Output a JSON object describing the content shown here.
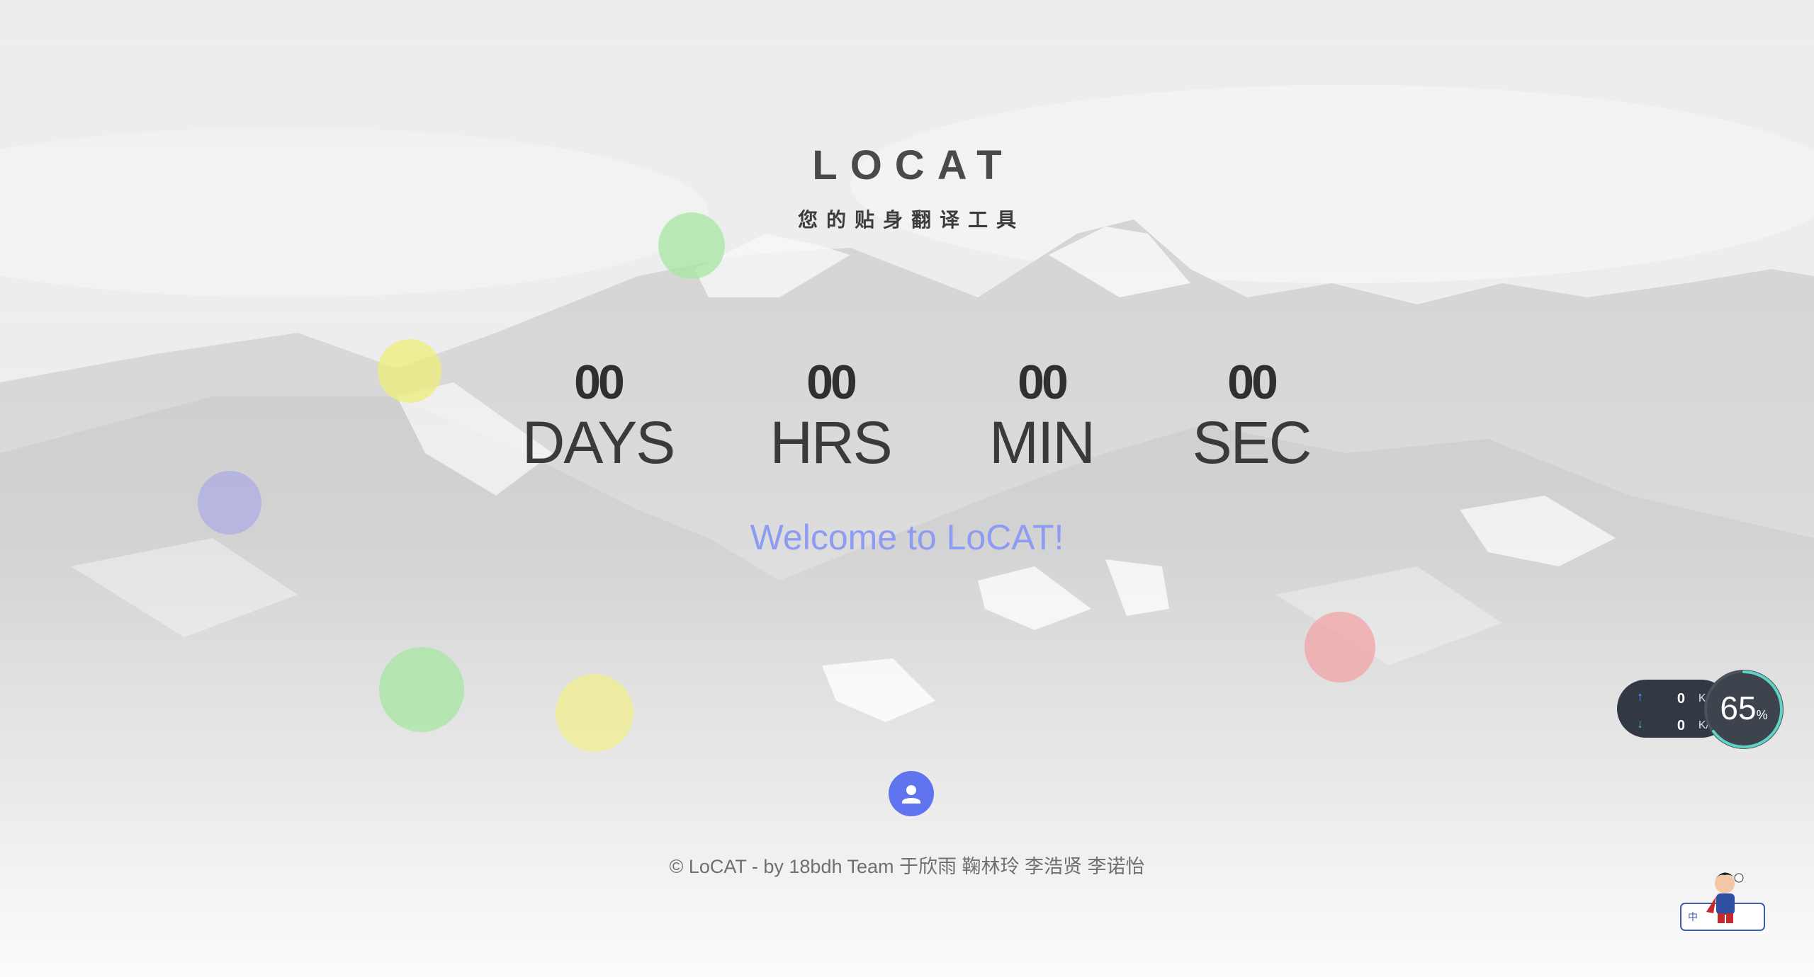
{
  "brand": {
    "title": "LOCAT",
    "subtitle": "您的贴身翻译工具"
  },
  "countdown": [
    {
      "value": "00",
      "label": "DAYS"
    },
    {
      "value": "00",
      "label": "HRS"
    },
    {
      "value": "00",
      "label": "MIN"
    },
    {
      "value": "00",
      "label": "SEC"
    }
  ],
  "welcome": "Welcome to LoCAT!",
  "footer": "© LoCAT - by 18bdh Team 于欣雨 鞠林玲 李浩贤 李诺怡",
  "network_monitor": {
    "upload_value": "0",
    "upload_unit": "K/s",
    "download_value": "0",
    "download_unit": "K/s",
    "usage_value": "65",
    "usage_unit": "%",
    "usage_fraction": 0.65
  },
  "bubbles": [
    {
      "color": "#a6e6a0"
    },
    {
      "color": "#eeee7a"
    },
    {
      "color": "#a9aae6"
    },
    {
      "color": "#a6e6a0"
    },
    {
      "color": "#f1ee8c"
    },
    {
      "color": "#f1a3a5"
    }
  ],
  "colors": {
    "welcome": "#8d9bf3",
    "avatar_button": "#5f74ee",
    "gauge_ring": "#5fd3c4",
    "upload_arrow": "#4aa3ff",
    "download_arrow": "#3ccf5a"
  },
  "icons": {
    "avatar_button": "user-icon",
    "upload": "arrow-up-icon",
    "download": "arrow-down-icon",
    "mascot": "mascot-widget-icon"
  },
  "mascot": {
    "badge_char": "中"
  }
}
